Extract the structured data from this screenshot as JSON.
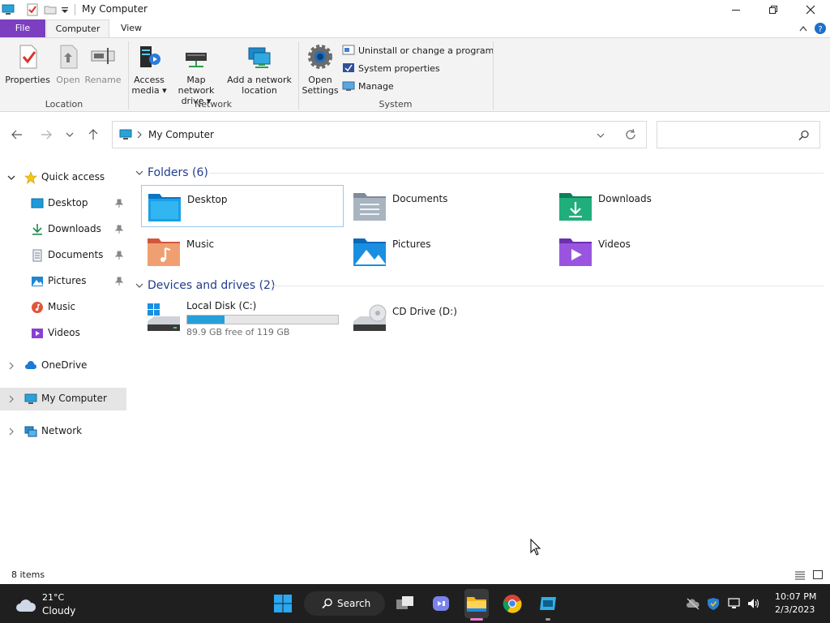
{
  "window": {
    "title": "My Computer"
  },
  "ribbon_tabs": {
    "file": "File",
    "computer": "Computer",
    "view": "View"
  },
  "ribbon": {
    "location": {
      "label": "Location",
      "properties": "Properties",
      "open": "Open",
      "rename": "Rename"
    },
    "network": {
      "label": "Network",
      "access_media_1": "Access",
      "access_media_2": "media ▾",
      "map_drive_1": "Map network",
      "map_drive_2": "drive ▾",
      "add_location_1": "Add a network",
      "add_location_2": "location"
    },
    "system": {
      "label": "System",
      "open_settings_1": "Open",
      "open_settings_2": "Settings",
      "uninstall": "Uninstall or change a program",
      "system_properties": "System properties",
      "manage": "Manage"
    }
  },
  "address": {
    "path": "My Computer",
    "search_placeholder": ""
  },
  "nav_pane": {
    "quick_access": "Quick access",
    "desktop": "Desktop",
    "downloads": "Downloads",
    "documents": "Documents",
    "pictures": "Pictures",
    "music": "Music",
    "videos": "Videos",
    "onedrive": "OneDrive",
    "my_computer": "My Computer",
    "network": "Network"
  },
  "content": {
    "folders_header": "Folders (6)",
    "folders": [
      "Desktop",
      "Documents",
      "Downloads",
      "Music",
      "Pictures",
      "Videos"
    ],
    "devices_header": "Devices and drives (2)",
    "local_disk": {
      "name": "Local Disk (C:)",
      "free": "89.9 GB free of 119 GB",
      "used_fraction": 0.245
    },
    "cd_drive": {
      "name": "CD Drive (D:)"
    }
  },
  "status": {
    "items": "8 items"
  },
  "taskbar": {
    "weather_temp": "21°C",
    "weather_desc": "Cloudy",
    "search": "Search",
    "time": "10:07 PM",
    "date": "2/3/2023"
  },
  "colors": {
    "file_tab": "#7b3fbf",
    "accent": "#0078d4",
    "drive_fill": "#26a0da",
    "taskbar": "#1f1f1f"
  }
}
